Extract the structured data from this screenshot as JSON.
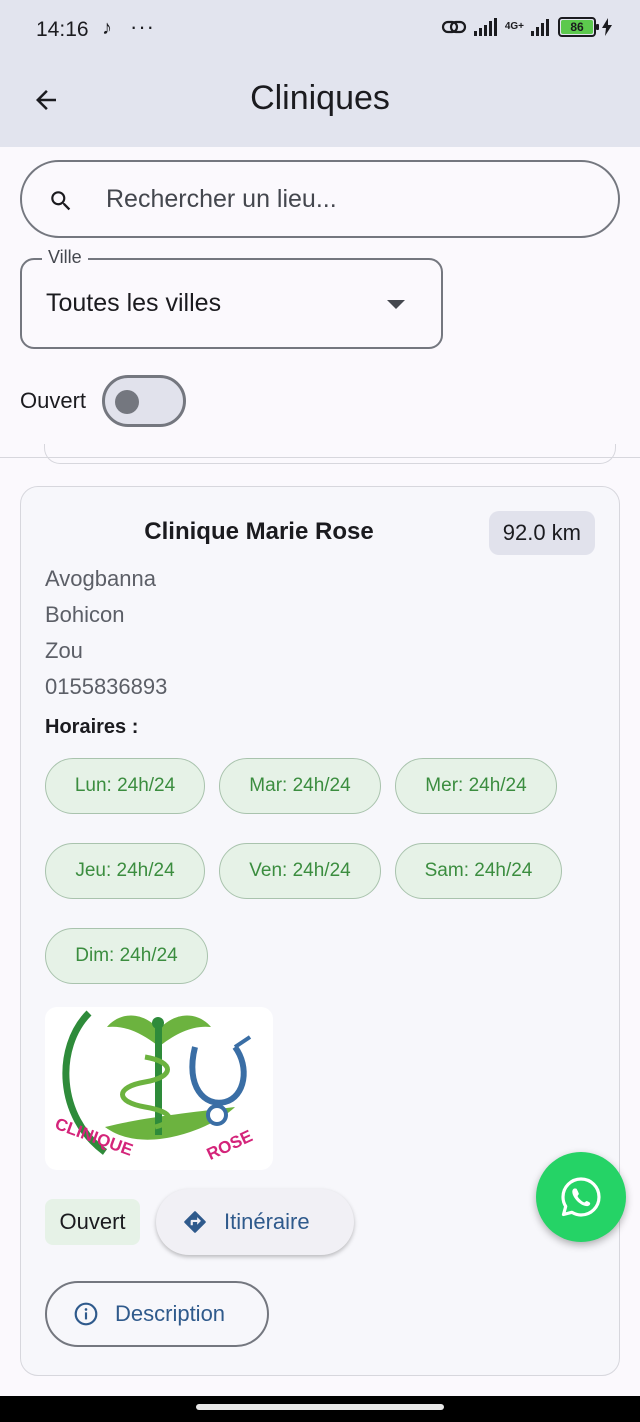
{
  "status_bar": {
    "time": "14:16",
    "battery": "86",
    "network": "4G+"
  },
  "app_bar": {
    "title": "Cliniques"
  },
  "search": {
    "placeholder": "Rechercher un lieu..."
  },
  "ville_filter": {
    "label": "Ville",
    "selected": "Toutes les villes"
  },
  "open_toggle": {
    "label": "Ouvert",
    "checked": false
  },
  "card": {
    "name": "Clinique Marie Rose",
    "distance": "92.0 km",
    "quartier": "Avogbanna",
    "ville": "Bohicon",
    "departement": "Zou",
    "phone": "0155836893",
    "horaires_label": "Horaires :",
    "horaires": [
      "Lun: 24h/24",
      "Mar: 24h/24",
      "Mer: 24h/24",
      "Jeu: 24h/24",
      "Ven: 24h/24",
      "Sam: 24h/24",
      "Dim: 24h/24"
    ],
    "logo_text": "CLINIQUE MARIE ROSE",
    "status": "Ouvert",
    "itinerary_label": "Itinéraire",
    "description_label": "Description"
  },
  "colors": {
    "accent": "#2f5a8c",
    "open_green": "#3b8d3f",
    "whatsapp": "#25d366",
    "appbar": "#e2e4ee"
  }
}
